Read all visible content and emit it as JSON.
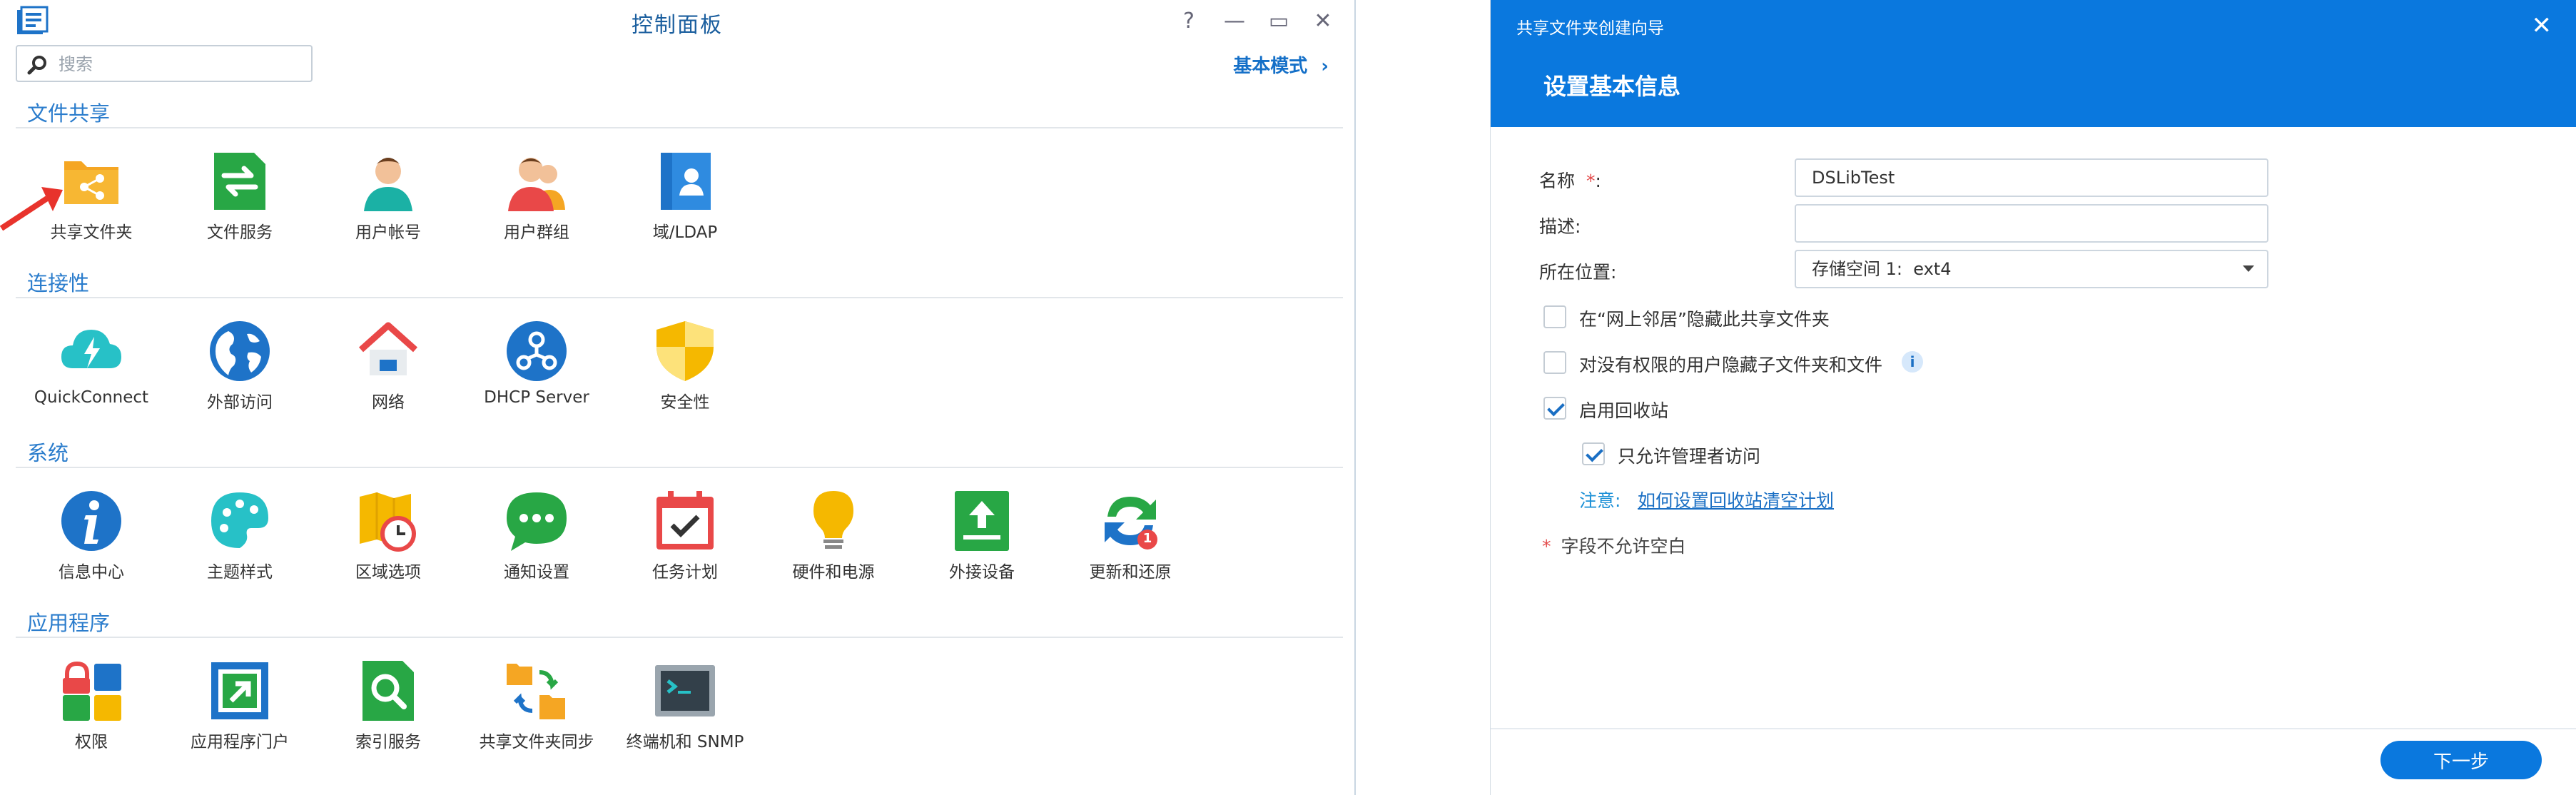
{
  "control_panel": {
    "title": "控制面板",
    "window_controls": {
      "help": "?",
      "minimize": "—",
      "maximize": "▭",
      "close": "✕"
    },
    "search": {
      "placeholder": "搜索",
      "value": ""
    },
    "basic_mode_label": "基本模式",
    "sections": [
      {
        "title": "文件共享",
        "items": [
          {
            "label": "共享文件夹",
            "icon": "shared-folder-icon"
          },
          {
            "label": "文件服务",
            "icon": "file-services-icon"
          },
          {
            "label": "用户帐号",
            "icon": "user-account-icon"
          },
          {
            "label": "用户群组",
            "icon": "user-group-icon"
          },
          {
            "label": "域/LDAP",
            "icon": "domain-ldap-icon"
          }
        ]
      },
      {
        "title": "连接性",
        "items": [
          {
            "label": "QuickConnect",
            "icon": "quickconnect-icon"
          },
          {
            "label": "外部访问",
            "icon": "external-access-icon"
          },
          {
            "label": "网络",
            "icon": "network-icon"
          },
          {
            "label": "DHCP Server",
            "icon": "dhcp-server-icon"
          },
          {
            "label": "安全性",
            "icon": "security-shield-icon"
          }
        ]
      },
      {
        "title": "系统",
        "items": [
          {
            "label": "信息中心",
            "icon": "info-center-icon"
          },
          {
            "label": "主题样式",
            "icon": "theme-palette-icon"
          },
          {
            "label": "区域选项",
            "icon": "regional-options-icon"
          },
          {
            "label": "通知设置",
            "icon": "notification-icon"
          },
          {
            "label": "任务计划",
            "icon": "task-scheduler-icon"
          },
          {
            "label": "硬件和电源",
            "icon": "hardware-power-icon"
          },
          {
            "label": "外接设备",
            "icon": "external-devices-icon"
          },
          {
            "label": "更新和还原",
            "icon": "update-restore-icon",
            "badge": "1"
          }
        ]
      },
      {
        "title": "应用程序",
        "items": [
          {
            "label": "权限",
            "icon": "privileges-icon"
          },
          {
            "label": "应用程序门户",
            "icon": "application-portal-icon"
          },
          {
            "label": "索引服务",
            "icon": "indexing-service-icon"
          },
          {
            "label": "共享文件夹同步",
            "icon": "shared-folder-sync-icon"
          },
          {
            "label": "终端机和 SNMP",
            "icon": "terminal-snmp-icon"
          }
        ]
      }
    ]
  },
  "wizard": {
    "window_title": "共享文件夹创建向导",
    "step_title": "设置基本信息",
    "fields": {
      "name": {
        "label": "名称",
        "required_mark": "*",
        "suffix": ":",
        "value": "DSLibTest"
      },
      "description": {
        "label": "描述:",
        "value": ""
      },
      "location": {
        "label": "所在位置:",
        "value": "存储空间 1:  ext4"
      }
    },
    "checkboxes": [
      {
        "label": "在“网上邻居”隐藏此共享文件夹",
        "checked": false
      },
      {
        "label": "对没有权限的用户隐藏子文件夹和文件",
        "checked": false,
        "info_icon": "info-icon"
      },
      {
        "label": "启用回收站",
        "checked": true
      },
      {
        "label": "只允许管理者访问",
        "checked": true
      }
    ],
    "note_label": "注意:",
    "note_link": "如何设置回收站清空计划",
    "required_note_mark": "*",
    "required_note": "字段不允许空白",
    "next_button": "下一步"
  },
  "colors": {
    "accent_blue": "#0a78de",
    "section_blue": "#2a7ccc",
    "required_red": "#e34a4a"
  }
}
